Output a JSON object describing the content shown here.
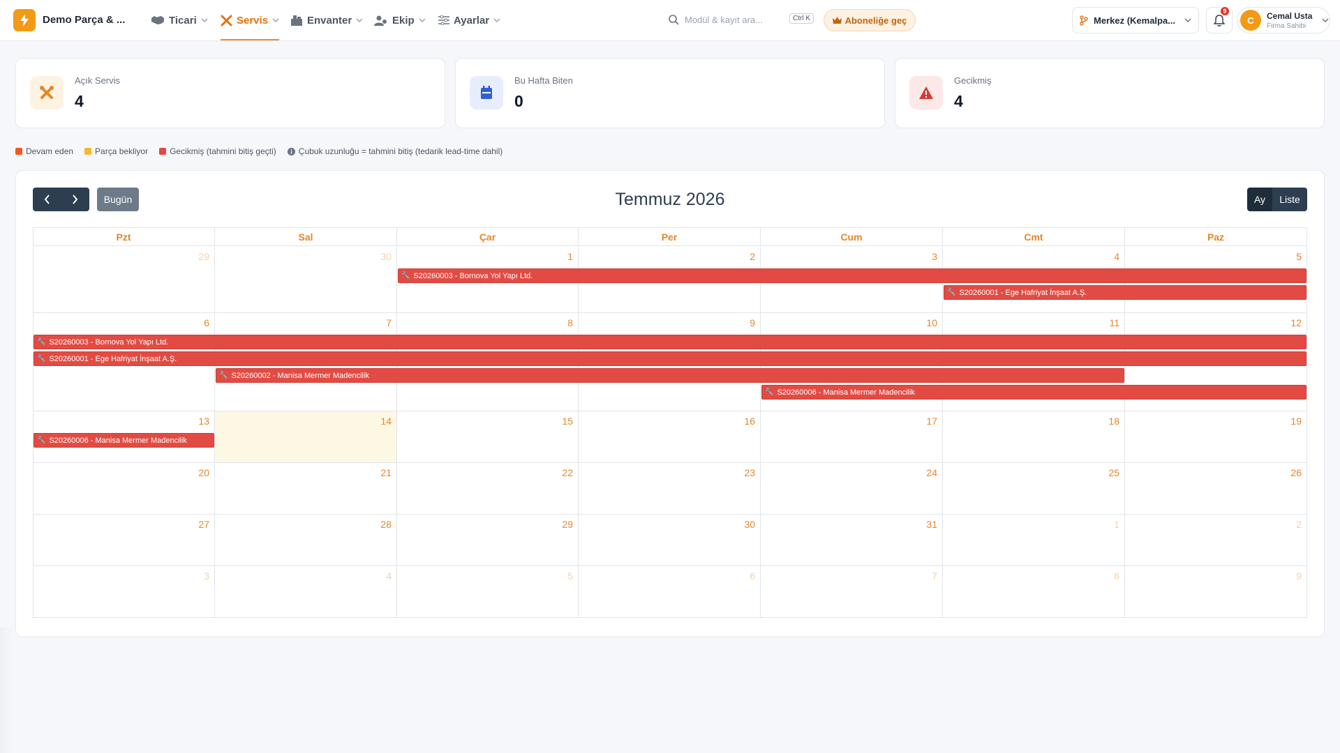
{
  "header": {
    "brand_name": "Demo Parça & ...",
    "nav": [
      {
        "label": "Ticari",
        "icon": "handshake-icon"
      },
      {
        "label": "Servis",
        "icon": "tools-icon",
        "active": true
      },
      {
        "label": "Envanter",
        "icon": "warehouse-icon"
      },
      {
        "label": "Ekip",
        "icon": "team-icon"
      },
      {
        "label": "Ayarlar",
        "icon": "sliders-icon"
      }
    ],
    "search_placeholder": "Modül & kayıt ara...",
    "search_shortcut": "Ctrl K",
    "subscribe_label": "Aboneliğe geç",
    "branch_label": "Merkez (Kemalpa...",
    "notification_count": "9",
    "user": {
      "initial": "C",
      "name": "Cemal Usta",
      "role": "Firma Sahibi"
    }
  },
  "stats": [
    {
      "label": "Açık Servis",
      "value": "4",
      "icon": "tools-icon"
    },
    {
      "label": "Bu Hafta Biten",
      "value": "0",
      "icon": "calendar-icon"
    },
    {
      "label": "Gecikmiş",
      "value": "4",
      "icon": "warning-icon"
    }
  ],
  "legend": [
    {
      "label": "Devam eden",
      "color": "#ee5a24"
    },
    {
      "label": "Parça bekliyor",
      "color": "#f5b82e"
    },
    {
      "label": "Gecikmiş (tahmini bitiş geçti)",
      "color": "#e24b43"
    },
    {
      "label": "Çubuk uzunluğu = tahmini bitiş (tedarik lead-time dahil)",
      "icon": "info-icon"
    }
  ],
  "calendar": {
    "title": "Temmuz 2026",
    "today_label": "Bugün",
    "view_month": "Ay",
    "view_list": "Liste",
    "weekdays": [
      "Pzt",
      "Sal",
      "Çar",
      "Per",
      "Cum",
      "Cmt",
      "Paz"
    ],
    "weeks": [
      [
        {
          "d": "29",
          "o": true
        },
        {
          "d": "30",
          "o": true
        },
        {
          "d": "1"
        },
        {
          "d": "2"
        },
        {
          "d": "3"
        },
        {
          "d": "4"
        },
        {
          "d": "5"
        }
      ],
      [
        {
          "d": "6"
        },
        {
          "d": "7"
        },
        {
          "d": "8"
        },
        {
          "d": "9"
        },
        {
          "d": "10"
        },
        {
          "d": "11"
        },
        {
          "d": "12"
        }
      ],
      [
        {
          "d": "13"
        },
        {
          "d": "14",
          "today": true
        },
        {
          "d": "15"
        },
        {
          "d": "16"
        },
        {
          "d": "17"
        },
        {
          "d": "18"
        },
        {
          "d": "19"
        }
      ],
      [
        {
          "d": "20"
        },
        {
          "d": "21"
        },
        {
          "d": "22"
        },
        {
          "d": "23"
        },
        {
          "d": "24"
        },
        {
          "d": "25"
        },
        {
          "d": "26"
        }
      ],
      [
        {
          "d": "27"
        },
        {
          "d": "28"
        },
        {
          "d": "29"
        },
        {
          "d": "30"
        },
        {
          "d": "31"
        },
        {
          "d": "1",
          "o": true
        },
        {
          "d": "2",
          "o": true
        }
      ],
      [
        {
          "d": "3",
          "o": true
        },
        {
          "d": "4",
          "o": true
        },
        {
          "d": "5",
          "o": true
        },
        {
          "d": "6",
          "o": true
        },
        {
          "d": "7",
          "o": true
        },
        {
          "d": "8",
          "o": true
        },
        {
          "d": "9",
          "o": true
        }
      ]
    ],
    "events": [
      {
        "label": "S20260003 - Bornova Yol Yapı Ltd.",
        "week": 0,
        "start": 2,
        "end": 6,
        "lane": 0
      },
      {
        "label": "S20260001 - Ege Hafriyat İnşaat A.Ş.",
        "week": 0,
        "start": 5,
        "end": 6,
        "lane": 1
      },
      {
        "label": "S20260003 - Bornova Yol Yapı Ltd.",
        "week": 1,
        "start": 0,
        "end": 6,
        "lane": 0
      },
      {
        "label": "S20260001 - Ege Hafriyat İnşaat A.Ş.",
        "week": 1,
        "start": 0,
        "end": 6,
        "lane": 1
      },
      {
        "label": "S20260002 - Manisa Mermer Madencilik",
        "week": 1,
        "start": 1,
        "end": 5,
        "lane": 2
      },
      {
        "label": "S20260006 - Manisa Mermer Madencilik",
        "week": 1,
        "start": 4,
        "end": 6,
        "lane": 3
      },
      {
        "label": "S20260006 - Manisa Mermer Madencilik",
        "week": 2,
        "start": 0,
        "end": 0,
        "lane": 0
      }
    ]
  }
}
